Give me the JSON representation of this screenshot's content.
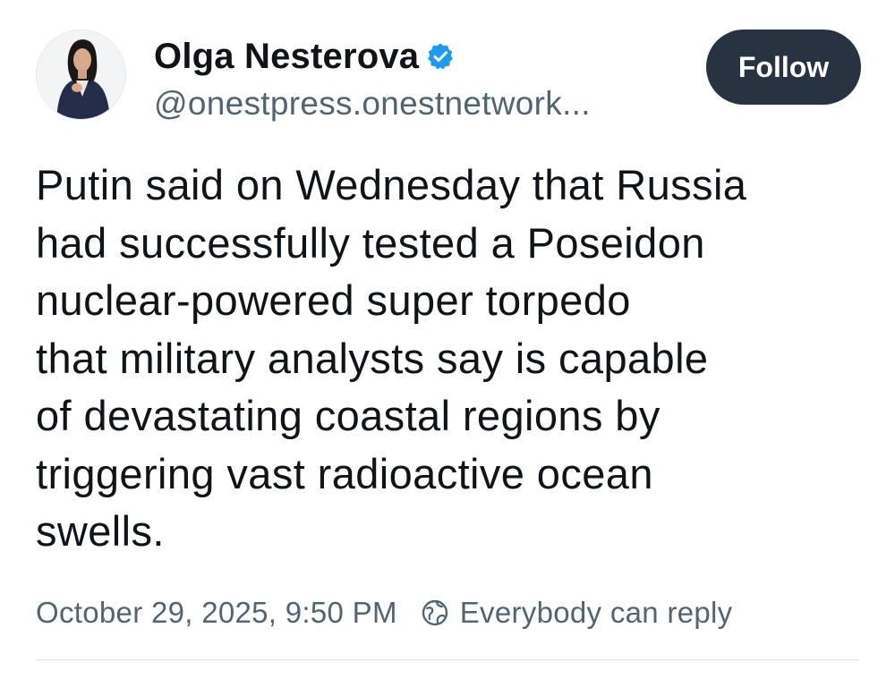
{
  "author": {
    "display_name": "Olga Nesterova",
    "handle": "@onestpress.onestnetwork...",
    "verified": true
  },
  "follow_button": {
    "label": "Follow"
  },
  "post": {
    "text_lines": [
      "Putin said on Wednesday that Russia",
      "had successfully tested a Poseidon",
      "nuclear-powered super torpedo",
      "that military analysts say is capable",
      "of devastating coastal regions by",
      "triggering vast radioactive ocean",
      "swells."
    ],
    "timestamp": "October 29, 2025, 9:50 PM",
    "reply_setting": "Everybody can reply"
  },
  "icons": {
    "verified": "verified-badge-icon",
    "reply_setting": "globe-icon"
  },
  "colors": {
    "accent": "#1d9bf0",
    "follow_bg": "#273340",
    "secondary_text": "#536471",
    "primary_text": "#0f1419"
  }
}
